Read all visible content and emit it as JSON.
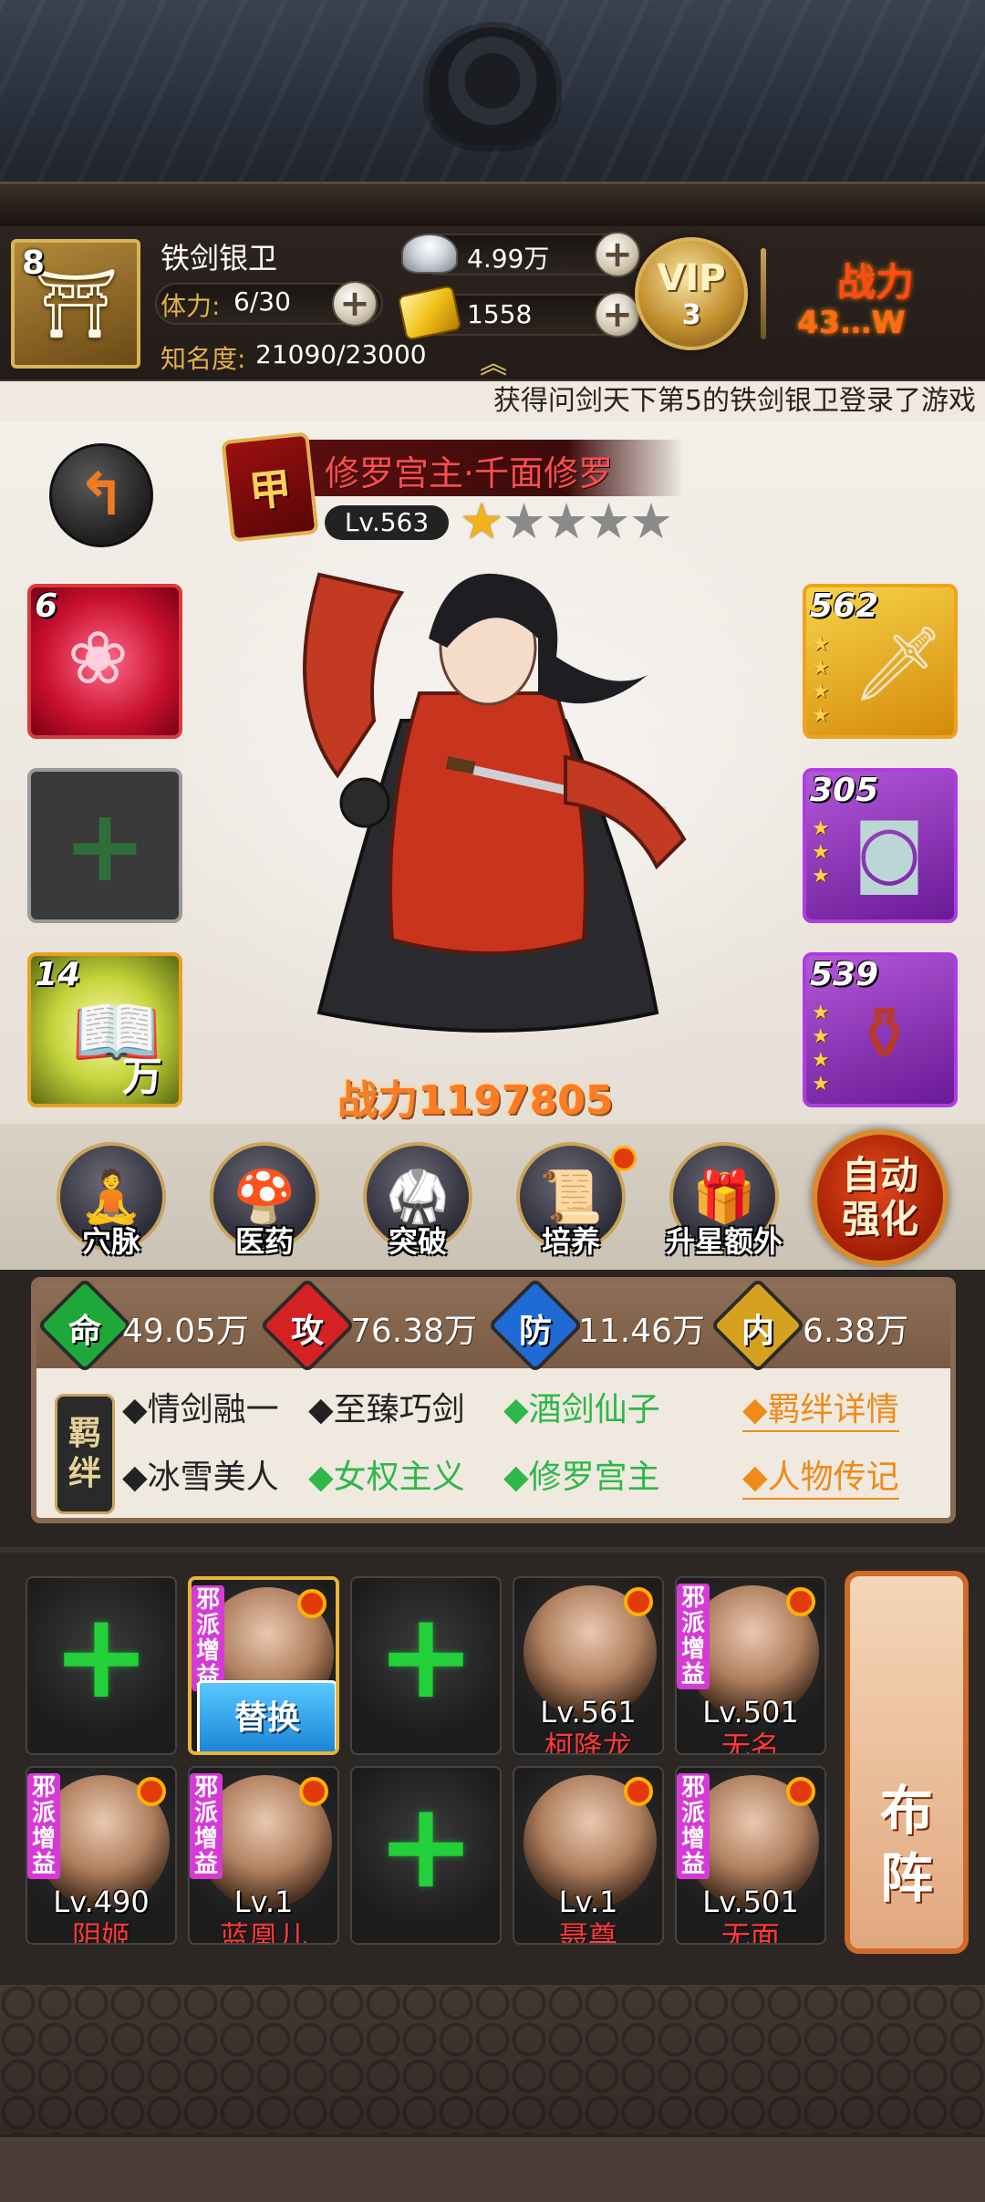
{
  "player": {
    "level": "8",
    "name": "铁剑银卫",
    "stamina_label": "体力:",
    "stamina_value": "6/30",
    "fame_label": "知名度:",
    "fame_value": "21090/23000",
    "silver": "4.99万",
    "gold": "1558",
    "vip_text": "VIP",
    "vip_level": "3",
    "power_label": "战力",
    "power_value": "43…W"
  },
  "marquee": "获得问剑天下第5的铁剑银卫登录了游戏",
  "hero": {
    "rank": "甲",
    "name": "修罗宫主·千面修罗",
    "level": "Lv.563",
    "stars_filled": 1,
    "stars_total": 5,
    "power": "战力1197805"
  },
  "equip_left": [
    {
      "num": "6",
      "type": "skill"
    },
    {
      "num": "",
      "type": "empty"
    },
    {
      "num": "14",
      "type": "book",
      "text": "万"
    }
  ],
  "equip_right": [
    {
      "num": "562",
      "type": "sword"
    },
    {
      "num": "305",
      "type": "bracer"
    },
    {
      "num": "539",
      "type": "vase"
    }
  ],
  "functions": [
    {
      "label": "穴脉"
    },
    {
      "label": "医药"
    },
    {
      "label": "突破"
    },
    {
      "label": "培养"
    },
    {
      "label": "升星额外"
    }
  ],
  "auto_button": "自动强化",
  "stats": [
    {
      "char": "命",
      "value": "49.05万",
      "color": "#1fa83a"
    },
    {
      "char": "攻",
      "value": "76.38万",
      "color": "#d42222"
    },
    {
      "char": "防",
      "value": "11.46万",
      "color": "#1f6ad4"
    },
    {
      "char": "内",
      "value": "6.38万",
      "color": "#d4a21f"
    }
  ],
  "bond_tag": "羁绊",
  "bonds_row1": [
    {
      "text": "◆情剑融一",
      "active": false
    },
    {
      "text": "◆至臻巧剑",
      "active": false
    },
    {
      "text": "◆酒剑仙子",
      "active": true
    }
  ],
  "bonds_row2": [
    {
      "text": "◆冰雪美人",
      "active": false
    },
    {
      "text": "◆女权主义",
      "active": true
    },
    {
      "text": "◆修罗宫主",
      "active": true
    }
  ],
  "bond_links": [
    "◆羁绊详情",
    "◆人物传记"
  ],
  "team": {
    "replace_label": "替换",
    "evil_tag": "邪派增益",
    "row1": [
      {
        "empty": true
      },
      {
        "empty": false,
        "selected": true,
        "tag": true
      },
      {
        "empty": true
      },
      {
        "empty": false,
        "level": "Lv.561",
        "name": "柯降龙",
        "tag": false
      },
      {
        "empty": false,
        "level": "Lv.501",
        "name": "无名",
        "tag": true
      }
    ],
    "row2": [
      {
        "empty": false,
        "level": "Lv.490",
        "name": "阴姬",
        "tag": true
      },
      {
        "empty": false,
        "level": "Lv.1",
        "name": "蓝凰儿",
        "tag": true
      },
      {
        "empty": true
      },
      {
        "empty": false,
        "level": "Lv.1",
        "name": "聂尊",
        "tag": false
      },
      {
        "empty": false,
        "level": "Lv.501",
        "name": "无面",
        "tag": true
      }
    ],
    "formation_label": "布阵"
  }
}
